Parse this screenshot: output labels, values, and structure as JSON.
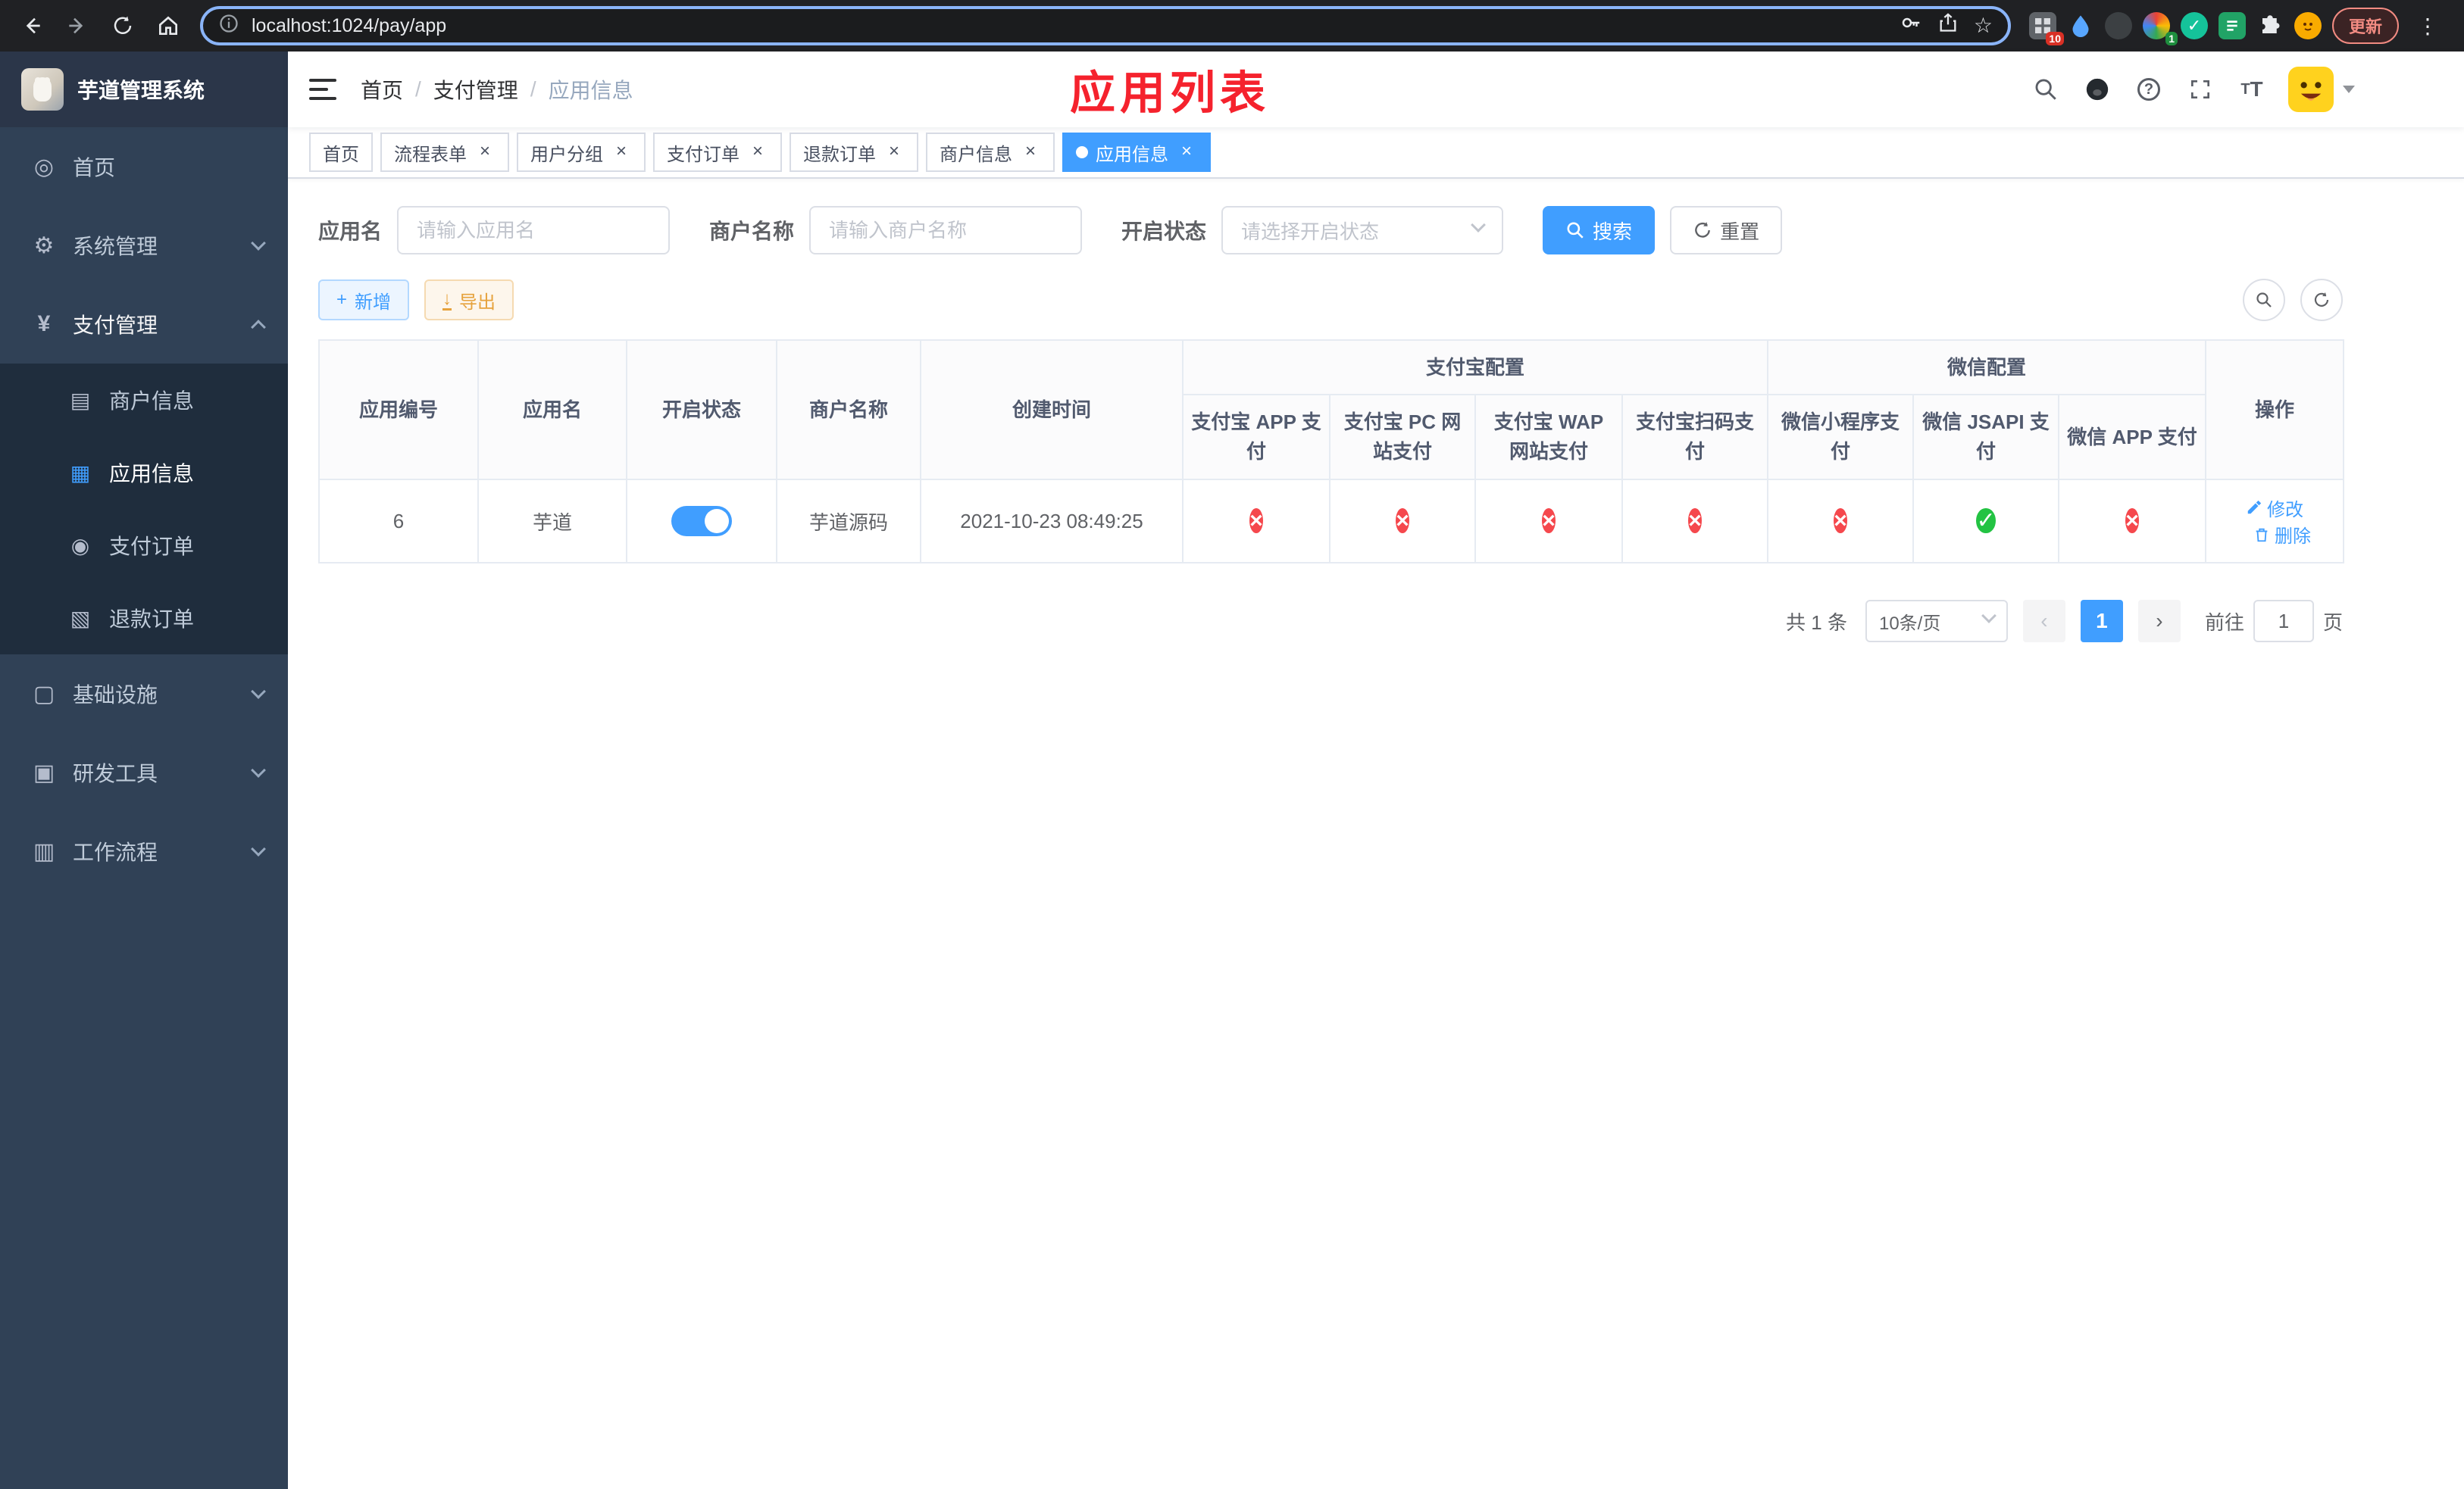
{
  "browser": {
    "url": "localhost:1024/pay/app",
    "update_label": "更新",
    "ext_badge_a": "10",
    "ext_badge_b": "1"
  },
  "sidebar": {
    "title": "芋道管理系统",
    "items": [
      {
        "label": "首页"
      },
      {
        "label": "系统管理"
      },
      {
        "label": "支付管理"
      },
      {
        "label": "基础设施"
      },
      {
        "label": "研发工具"
      },
      {
        "label": "工作流程"
      }
    ],
    "payment_children": [
      {
        "label": "商户信息"
      },
      {
        "label": "应用信息"
      },
      {
        "label": "支付订单"
      },
      {
        "label": "退款订单"
      }
    ]
  },
  "header": {
    "breadcrumb": [
      "首页",
      "支付管理",
      "应用信息"
    ],
    "annotation": "应用列表"
  },
  "tabs": [
    {
      "label": "首页",
      "closable": false,
      "active": false
    },
    {
      "label": "流程表单",
      "closable": true,
      "active": false
    },
    {
      "label": "用户分组",
      "closable": true,
      "active": false
    },
    {
      "label": "支付订单",
      "closable": true,
      "active": false
    },
    {
      "label": "退款订单",
      "closable": true,
      "active": false
    },
    {
      "label": "商户信息",
      "closable": true,
      "active": false
    },
    {
      "label": "应用信息",
      "closable": true,
      "active": true
    }
  ],
  "filters": {
    "app_name_label": "应用名",
    "app_name_placeholder": "请输入应用名",
    "merchant_label": "商户名称",
    "merchant_placeholder": "请输入商户名称",
    "status_label": "开启状态",
    "status_placeholder": "请选择开启状态",
    "search_label": "搜索",
    "reset_label": "重置"
  },
  "toolbar": {
    "add_label": "新增",
    "export_label": "导出"
  },
  "table": {
    "col_headers": [
      "应用编号",
      "应用名",
      "开启状态",
      "商户名称",
      "创建时间",
      "操作"
    ],
    "group_headers": [
      "支付宝配置",
      "微信配置"
    ],
    "sub_headers": [
      "支付宝 APP 支付",
      "支付宝 PC 网站支付",
      "支付宝 WAP 网站支付",
      "支付宝扫码支付",
      "微信小程序支付",
      "微信 JSAPI 支付",
      "微信 APP 支付"
    ],
    "row": {
      "id": "6",
      "name": "芋道",
      "status_on": true,
      "merchant": "芋道源码",
      "created_at": "2021-10-23 08:49:25",
      "configs": [
        "fail",
        "fail",
        "fail",
        "fail",
        "fail",
        "success",
        "fail"
      ],
      "edit_label": "修改",
      "delete_label": "删除"
    }
  },
  "pagination": {
    "total_text": "共 1 条",
    "page_size_text": "10条/页",
    "prev": "‹",
    "next": "›",
    "current_page": "1",
    "goto_prefix": "前往",
    "goto_value": "1",
    "goto_suffix": "页"
  },
  "icons": {
    "dashboard": "◎",
    "gear": "⚙",
    "yen": "¥",
    "merchant": "▤",
    "app": "▦",
    "order": "◉",
    "refund": "▧",
    "infra": "▢",
    "devtool": "▣",
    "workflow": "▥",
    "cross": "×",
    "check": "✓",
    "plus": "+",
    "download": "↓",
    "star": "☆",
    "dots_menu": "⋮"
  },
  "colors": {
    "primary": "#409eff",
    "danger": "#f5484d",
    "success": "#23c343",
    "annotation": "#f5222d"
  }
}
